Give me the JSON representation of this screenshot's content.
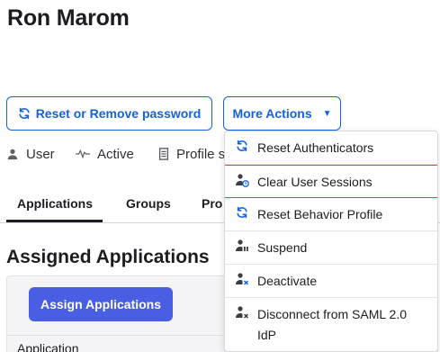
{
  "user": {
    "name": "Ron Marom"
  },
  "actions": {
    "reset_password_label": "Reset or Remove password",
    "more_actions_label": "More Actions"
  },
  "meta": {
    "type": "User",
    "status": "Active",
    "profile": "Profile s"
  },
  "tabs": [
    {
      "label": "Applications",
      "active": true
    },
    {
      "label": "Groups"
    },
    {
      "label": "Pro"
    }
  ],
  "section": {
    "title": "Assigned Applications"
  },
  "assign_button_label": "Assign Applications",
  "table": {
    "column_header": "Application"
  },
  "dropdown": {
    "items": [
      {
        "label": "Reset Authenticators",
        "icon": "refresh-icon"
      },
      {
        "label": "Clear User Sessions",
        "icon": "user-clock-icon",
        "highlighted": true
      },
      {
        "label": "Reset Behavior Profile",
        "icon": "refresh-icon"
      },
      {
        "label": "Suspend",
        "icon": "user-pause-icon"
      },
      {
        "label": "Deactivate",
        "icon": "user-x-icon"
      },
      {
        "label": "Disconnect from SAML 2.0 IdP",
        "icon": "user-disconnect-icon"
      }
    ]
  },
  "colors": {
    "primary": "#1662dd",
    "assign_button": "#4a5ee3",
    "highlight_border": "#d9462b"
  }
}
